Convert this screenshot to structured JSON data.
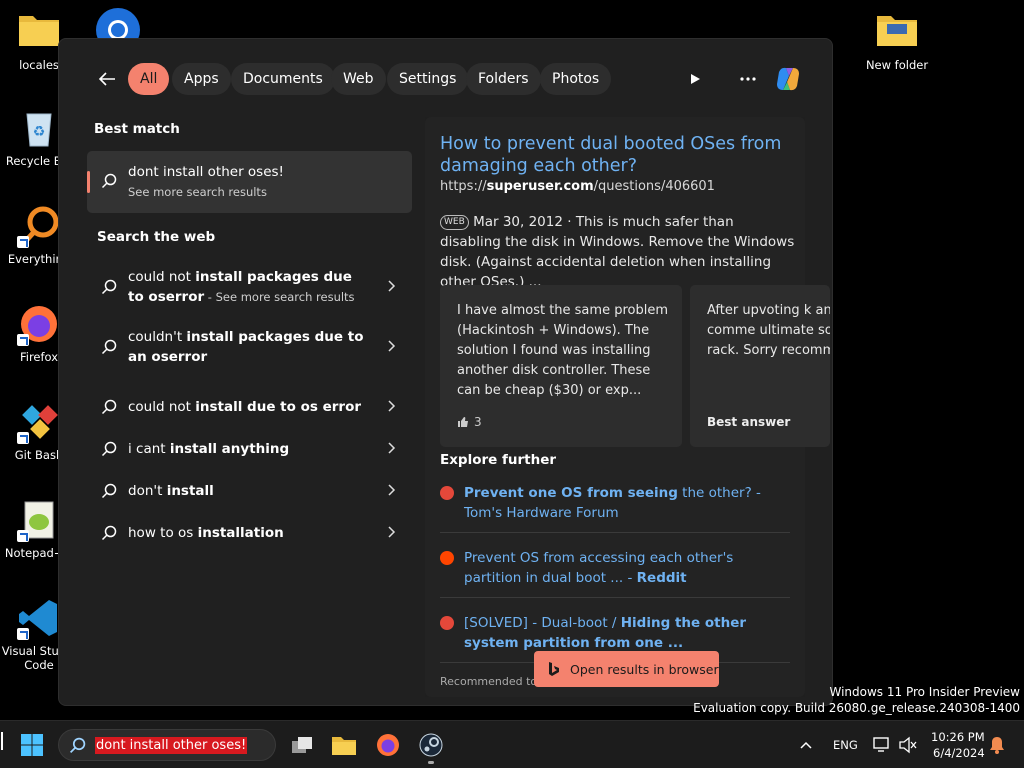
{
  "desktop": {
    "icons": [
      {
        "label": "locales"
      },
      {
        "label": "Recycle Bin"
      },
      {
        "label": "Everything"
      },
      {
        "label": "Firefox"
      },
      {
        "label": "Git Bash"
      },
      {
        "label": "Notepad++"
      },
      {
        "label": "Visual Studio Code"
      },
      {
        "label": "New folder"
      }
    ]
  },
  "filters": [
    "All",
    "Apps",
    "Documents",
    "Web",
    "Settings",
    "Folders",
    "Photos"
  ],
  "best_match": {
    "heading": "Best match",
    "title": "dont install other oses!",
    "subtitle": "See more search results"
  },
  "search_web": {
    "heading": "Search the web",
    "items": [
      {
        "plain": "could not ",
        "bold": "install packages due to oserror",
        "extra": " - See more search results"
      },
      {
        "plain": "couldn't ",
        "bold": "install packages due to an oserror",
        "extra": ""
      },
      {
        "plain": "could not ",
        "bold": "install due to os error",
        "extra": ""
      },
      {
        "plain": "i cant ",
        "bold": "install anything",
        "extra": ""
      },
      {
        "plain": "don't ",
        "bold": "install",
        "extra": ""
      },
      {
        "plain": "how to os ",
        "bold": "installation",
        "extra": ""
      }
    ]
  },
  "result": {
    "title": "How to prevent dual booted OSes from damaging each other?",
    "url_prefix": "https://",
    "url_domain": "superuser.com",
    "url_path": "/questions/406601",
    "badge": "WEB",
    "snippet": "Mar 30, 2012 · This is much safer than disabling the disk in Windows. Remove the Windows disk. (Against accidental deletion when installing other OSes.) ...",
    "cards": [
      {
        "text": "I have almost the same problem (Hackintosh + Windows). The solution I found was installing another disk controller. These can be cheap ($30) or exp...",
        "footer": "3"
      },
      {
        "text": "After upvoting k and jet's comme ultimate solution front-rack. Sorry recommendations",
        "footer": "Best answer"
      }
    ],
    "explore_heading": "Explore further",
    "explore": [
      {
        "bold": "Prevent one OS from seeing",
        "plain": " the other? - Tom's Hardware Forum",
        "color": "#e4483a"
      },
      {
        "bold": "",
        "plain": "Prevent OS from accessing each other's partition in dual boot ... - ",
        "bold_end": "Reddit",
        "color": "#ff4500"
      },
      {
        "bold": "",
        "plain": "[SOLVED] - Dual-boot / ",
        "bold_end": "Hiding the other system partition from one ...",
        "color": "#e4483a"
      }
    ],
    "recommended": "Recommended to y"
  },
  "open_browser": "Open results in browser",
  "watermark": {
    "line1": "Windows 11 Pro Insider Preview",
    "line2": "Evaluation copy. Build 26080.ge_release.240308-1400"
  },
  "taskbar": {
    "search_text": "dont install other oses!",
    "lang": "ENG",
    "time": "10:26 PM",
    "date": "6/4/2024"
  }
}
